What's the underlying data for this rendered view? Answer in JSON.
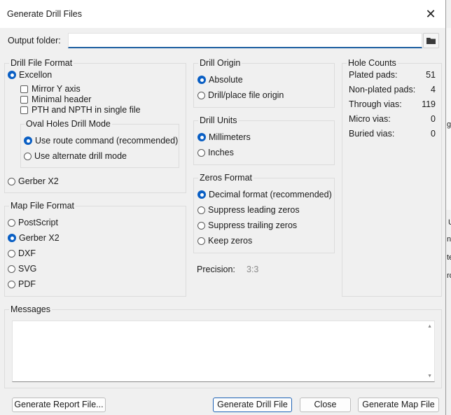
{
  "window": {
    "title": "Generate Drill Files",
    "close_glyph": "✕"
  },
  "output": {
    "label": "Output folder:",
    "value": ""
  },
  "drill_file_format": {
    "title": "Drill File Format",
    "excellon": "Excellon",
    "mirror_y": "Mirror Y axis",
    "minimal_header": "Minimal header",
    "pth_npth_single": "PTH and NPTH in single file",
    "oval_holes": {
      "title": "Oval Holes Drill Mode",
      "route": "Use route command (recommended)",
      "alternate": "Use alternate drill mode"
    },
    "gerber_x2": "Gerber X2"
  },
  "map_file_format": {
    "title": "Map File Format",
    "options": [
      "PostScript",
      "Gerber X2",
      "DXF",
      "SVG",
      "PDF"
    ],
    "selected": "Gerber X2"
  },
  "drill_origin": {
    "title": "Drill Origin",
    "absolute": "Absolute",
    "file_origin": "Drill/place file origin"
  },
  "drill_units": {
    "title": "Drill Units",
    "mm": "Millimeters",
    "inches": "Inches"
  },
  "zeros_format": {
    "title": "Zeros Format",
    "decimal": "Decimal format (recommended)",
    "leading": "Suppress leading zeros",
    "trailing": "Suppress trailing zeros",
    "keep": "Keep zeros"
  },
  "precision": {
    "label": "Precision:",
    "value": "3:3"
  },
  "hole_counts": {
    "title": "Hole Counts",
    "rows": [
      {
        "label": "Plated pads:",
        "value": "51"
      },
      {
        "label": "Non-plated pads:",
        "value": "4"
      },
      {
        "label": "Through vias:",
        "value": "119"
      },
      {
        "label": "Micro vias:",
        "value": "0"
      },
      {
        "label": "Buried vias:",
        "value": "0"
      }
    ]
  },
  "messages": {
    "title": "Messages",
    "content": ""
  },
  "buttons": {
    "report": "Generate Report File...",
    "drill": "Generate Drill File",
    "close": "Close",
    "map": "Generate Map File"
  },
  "background_fragments": [
    "g",
    "U",
    "na",
    "te",
    "ro"
  ],
  "colors": {
    "accent": "#0a5fc4",
    "input_underline": "#1c5ea0"
  }
}
